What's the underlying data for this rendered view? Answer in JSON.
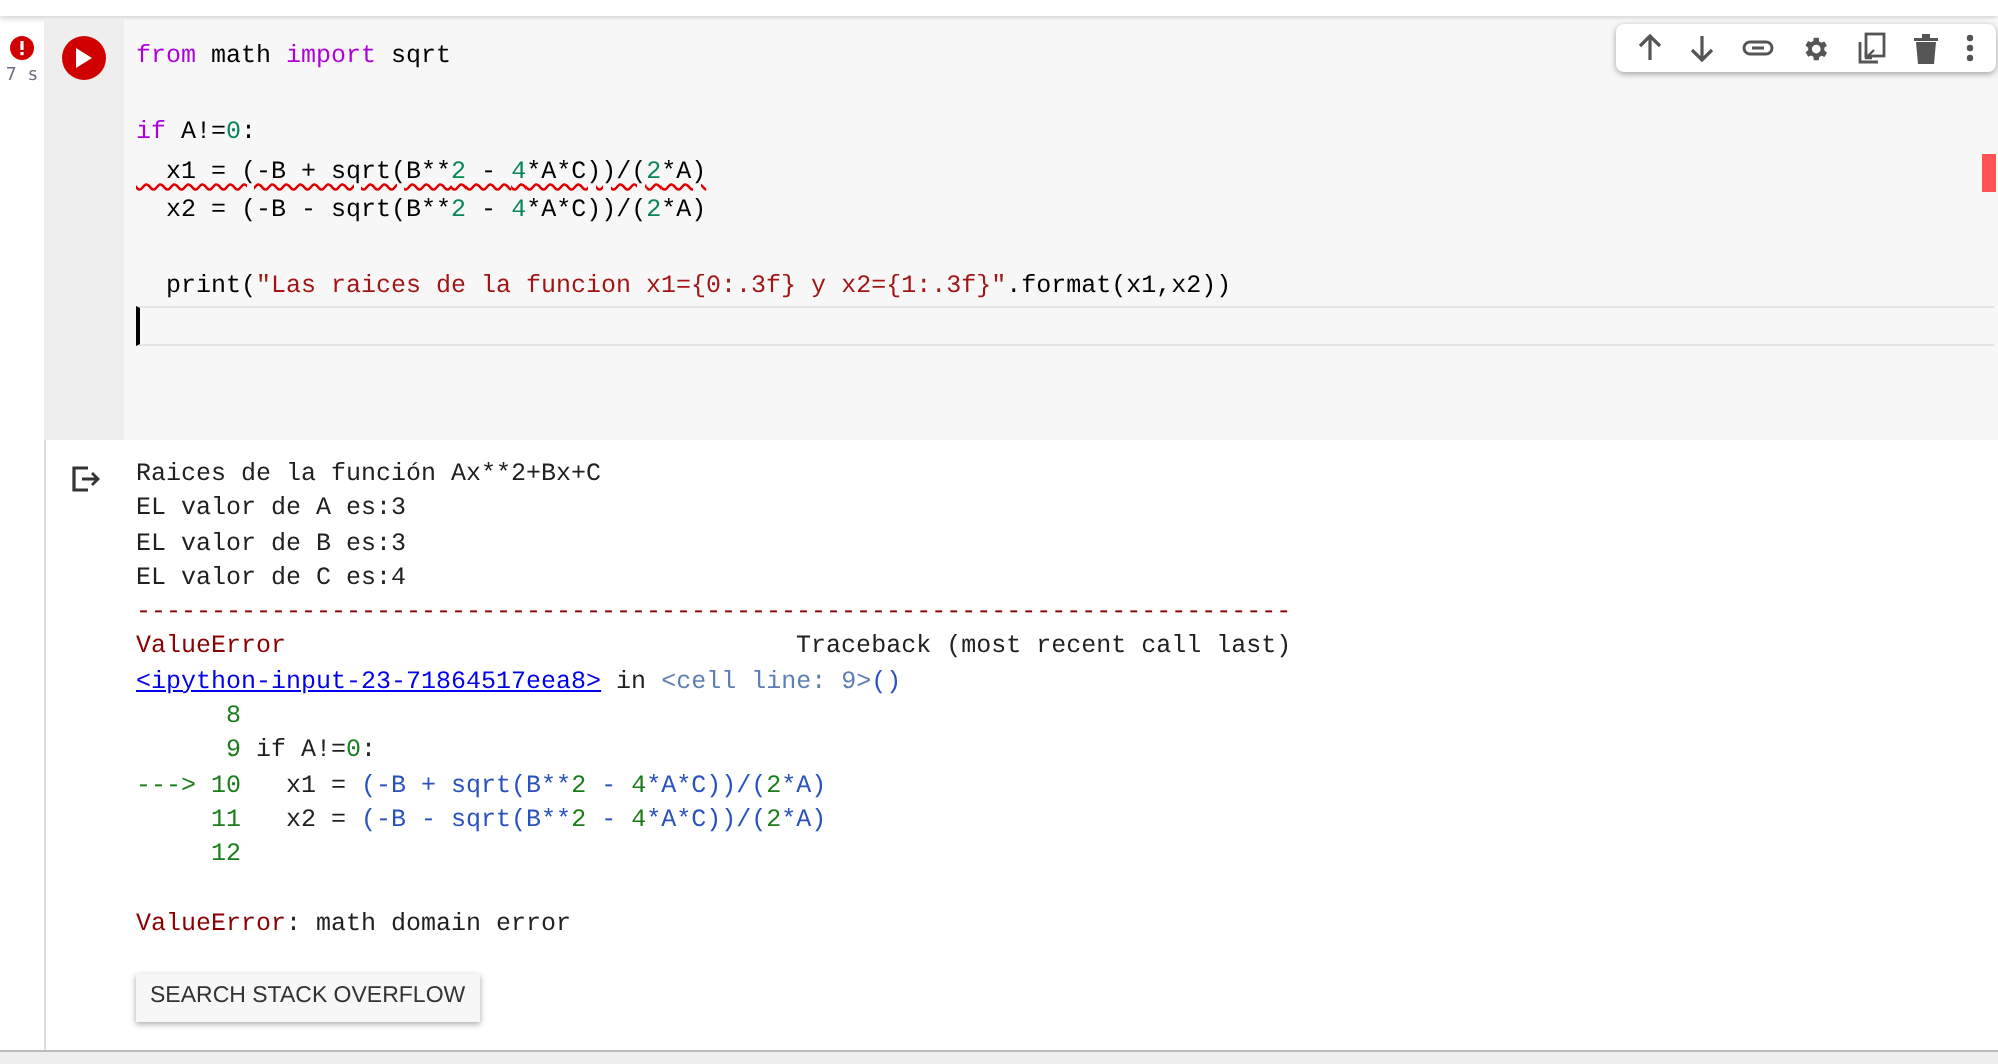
{
  "cell": {
    "error": true,
    "exec_time": "7 s",
    "focused": true,
    "code_blocks": [
      [
        {
          "squiggle": false,
          "tokens": [
            {
              "text": "from",
              "kind": "keyword"
            },
            {
              "text": " math ",
              "kind": "plain"
            },
            {
              "text": "import",
              "kind": "keyword"
            },
            {
              "text": " sqrt",
              "kind": "plain"
            }
          ]
        }
      ],
      [
        {
          "squiggle": false,
          "tokens": [
            {
              "text": "if",
              "kind": "keyword"
            },
            {
              "text": " A!=",
              "kind": "plain"
            },
            {
              "text": "0",
              "kind": "number"
            },
            {
              "text": ":",
              "kind": "plain"
            }
          ]
        },
        {
          "squiggle": true,
          "tokens": [
            {
              "text": "  x1 = (-B + sqrt(B**",
              "kind": "plain"
            },
            {
              "text": "2",
              "kind": "number"
            },
            {
              "text": " - ",
              "kind": "plain"
            },
            {
              "text": "4",
              "kind": "number"
            },
            {
              "text": "*A*C))/(",
              "kind": "plain"
            },
            {
              "text": "2",
              "kind": "number"
            },
            {
              "text": "*A)",
              "kind": "plain"
            }
          ]
        },
        {
          "squiggle": false,
          "tokens": [
            {
              "text": "  x2 = (-B - sqrt(B**",
              "kind": "plain"
            },
            {
              "text": "2",
              "kind": "number"
            },
            {
              "text": " - ",
              "kind": "plain"
            },
            {
              "text": "4",
              "kind": "number"
            },
            {
              "text": "*A*C))/(",
              "kind": "plain"
            },
            {
              "text": "2",
              "kind": "number"
            },
            {
              "text": "*A)",
              "kind": "plain"
            }
          ]
        }
      ],
      [
        {
          "squiggle": false,
          "tokens": [
            {
              "text": "  print(",
              "kind": "plain"
            },
            {
              "text": "\"Las raices de la funcion x1={0:.3f} y x2={1:.3f}\"",
              "kind": "string"
            },
            {
              "text": ".format(x1,x2))",
              "kind": "plain"
            }
          ]
        }
      ]
    ],
    "output_blocks": [
      [
        [
          {
            "text": "Raices de la función Ax**2+Bx+C",
            "kind": "text"
          }
        ],
        [
          {
            "text": "EL valor de A es:3",
            "kind": "text"
          }
        ],
        [
          {
            "text": "EL valor de B es:3",
            "kind": "text"
          }
        ],
        [
          {
            "text": "EL valor de C es:4",
            "kind": "text"
          }
        ],
        [
          {
            "text": "-----------------------------------------------------------------------------",
            "kind": "error"
          }
        ],
        [
          {
            "text": "ValueError",
            "kind": "error"
          },
          {
            "text": "                                  Traceback (most recent call last)",
            "kind": "text"
          }
        ],
        [
          {
            "text": "<ipython-input-23-71864517eea8>",
            "kind": "link"
          },
          {
            "text": " in ",
            "kind": "text"
          },
          {
            "text": "<cell line: 9>",
            "kind": "ref"
          },
          {
            "text": "()",
            "kind": "code"
          }
        ],
        [
          {
            "text": "      8",
            "kind": "lineno"
          }
        ],
        [
          {
            "text": "      9",
            "kind": "lineno"
          },
          {
            "text": " if A!=",
            "kind": "text"
          },
          {
            "text": "0",
            "kind": "number"
          },
          {
            "text": ":",
            "kind": "text"
          }
        ],
        [
          {
            "text": "---> 10",
            "kind": "lineno"
          },
          {
            "text": "   x1 = ",
            "kind": "text"
          },
          {
            "text": "(-B + sqrt(B**",
            "kind": "code"
          },
          {
            "text": "2",
            "kind": "number"
          },
          {
            "text": " - ",
            "kind": "code"
          },
          {
            "text": "4",
            "kind": "number"
          },
          {
            "text": "*A*C))/(",
            "kind": "code"
          },
          {
            "text": "2",
            "kind": "number"
          },
          {
            "text": "*A)",
            "kind": "code"
          }
        ],
        [
          {
            "text": "     11",
            "kind": "lineno"
          },
          {
            "text": "   x2 = ",
            "kind": "text"
          },
          {
            "text": "(-B - sqrt(B**",
            "kind": "code"
          },
          {
            "text": "2",
            "kind": "number"
          },
          {
            "text": " - ",
            "kind": "code"
          },
          {
            "text": "4",
            "kind": "number"
          },
          {
            "text": "*A*C))/(",
            "kind": "code"
          },
          {
            "text": "2",
            "kind": "number"
          },
          {
            "text": "*A)",
            "kind": "code"
          }
        ],
        [
          {
            "text": "     12",
            "kind": "lineno"
          }
        ]
      ],
      [
        [
          {
            "text": "ValueError",
            "kind": "error"
          },
          {
            "text": ": math domain error",
            "kind": "text"
          }
        ]
      ]
    ],
    "search_button": "SEARCH STACK OVERFLOW"
  }
}
